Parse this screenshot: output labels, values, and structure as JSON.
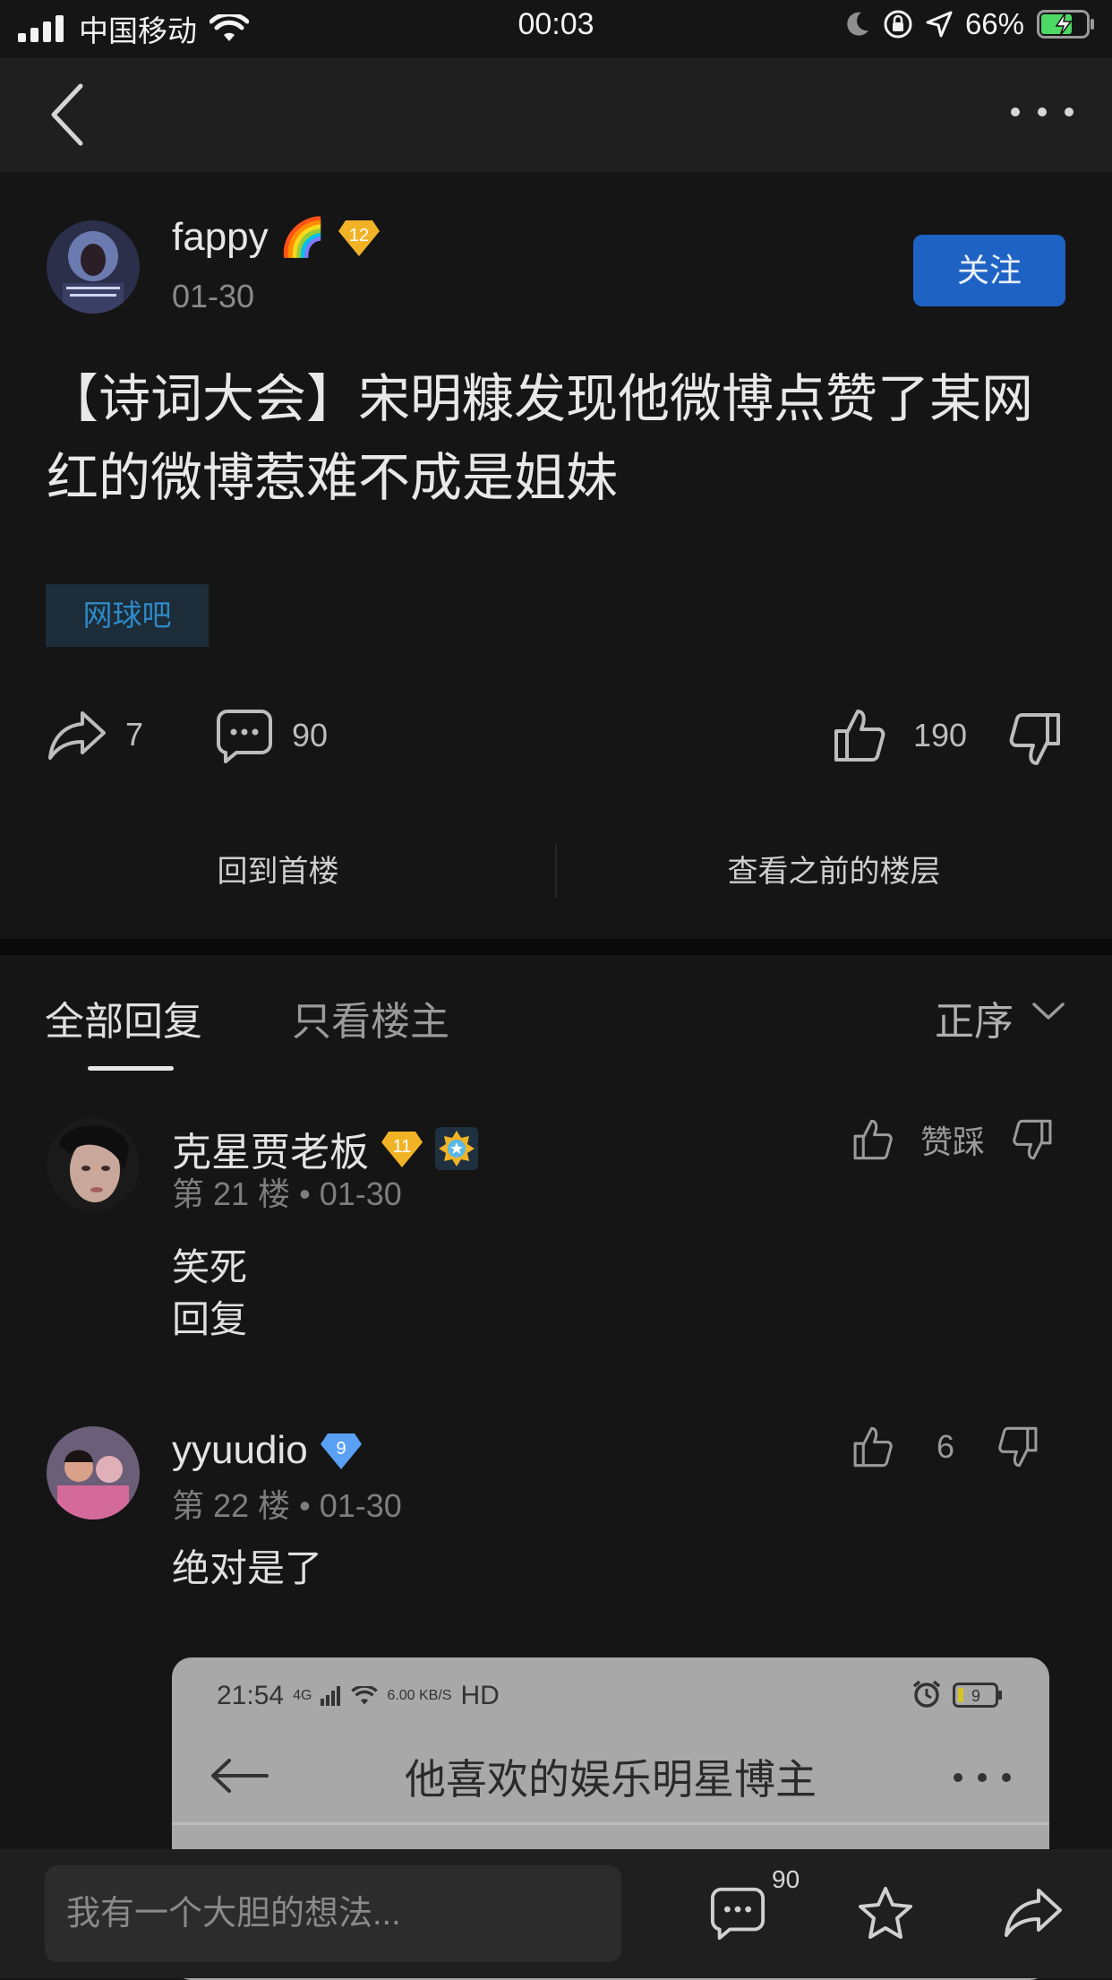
{
  "status_bar": {
    "carrier": "中国移动",
    "time": "00:03",
    "battery": "66%"
  },
  "post": {
    "author": "fappy",
    "author_emoji": "🌈",
    "level": "12",
    "date": "01-30",
    "follow_label": "关注",
    "title": "【诗词大会】宋明糠发现他微博点赞了某网红的微博惹难不成是姐妹",
    "forum_tag": "网球吧",
    "share_count": "7",
    "comment_count": "90",
    "like_count": "190",
    "back_to_first_floor": "回到首楼",
    "view_previous_floors": "查看之前的楼层"
  },
  "tabs": {
    "all_replies": "全部回复",
    "op_only": "只看楼主",
    "sort": "正序"
  },
  "replies": [
    {
      "name": "克星贾老板",
      "level": "11",
      "floor": "第 21 楼",
      "date": "01-30",
      "text_lines": [
        "笑死",
        "回复"
      ],
      "likes_label": "赞踩"
    },
    {
      "name": "yyuudio",
      "level": "9",
      "floor": "第 22 楼",
      "date": "01-30",
      "text_lines": [
        "绝对是了"
      ],
      "likes_label": "6"
    }
  ],
  "embedded_screenshot": {
    "time": "21:54",
    "network": "4G",
    "speed": "6.00 KB/S",
    "hd": "HD",
    "battery": "9",
    "title": "他喜欢的娱乐明星博主"
  },
  "bottom_bar": {
    "input_placeholder": "我有一个大胆的想法...",
    "comment_count": "90"
  },
  "colors": {
    "background": "#151515",
    "navbar": "#1f1f1f",
    "follow_button": "#1e62c4",
    "forum_tag_text": "#2e89c7",
    "level_gold": "#f1b325",
    "level_blue": "#5aa0f5"
  }
}
